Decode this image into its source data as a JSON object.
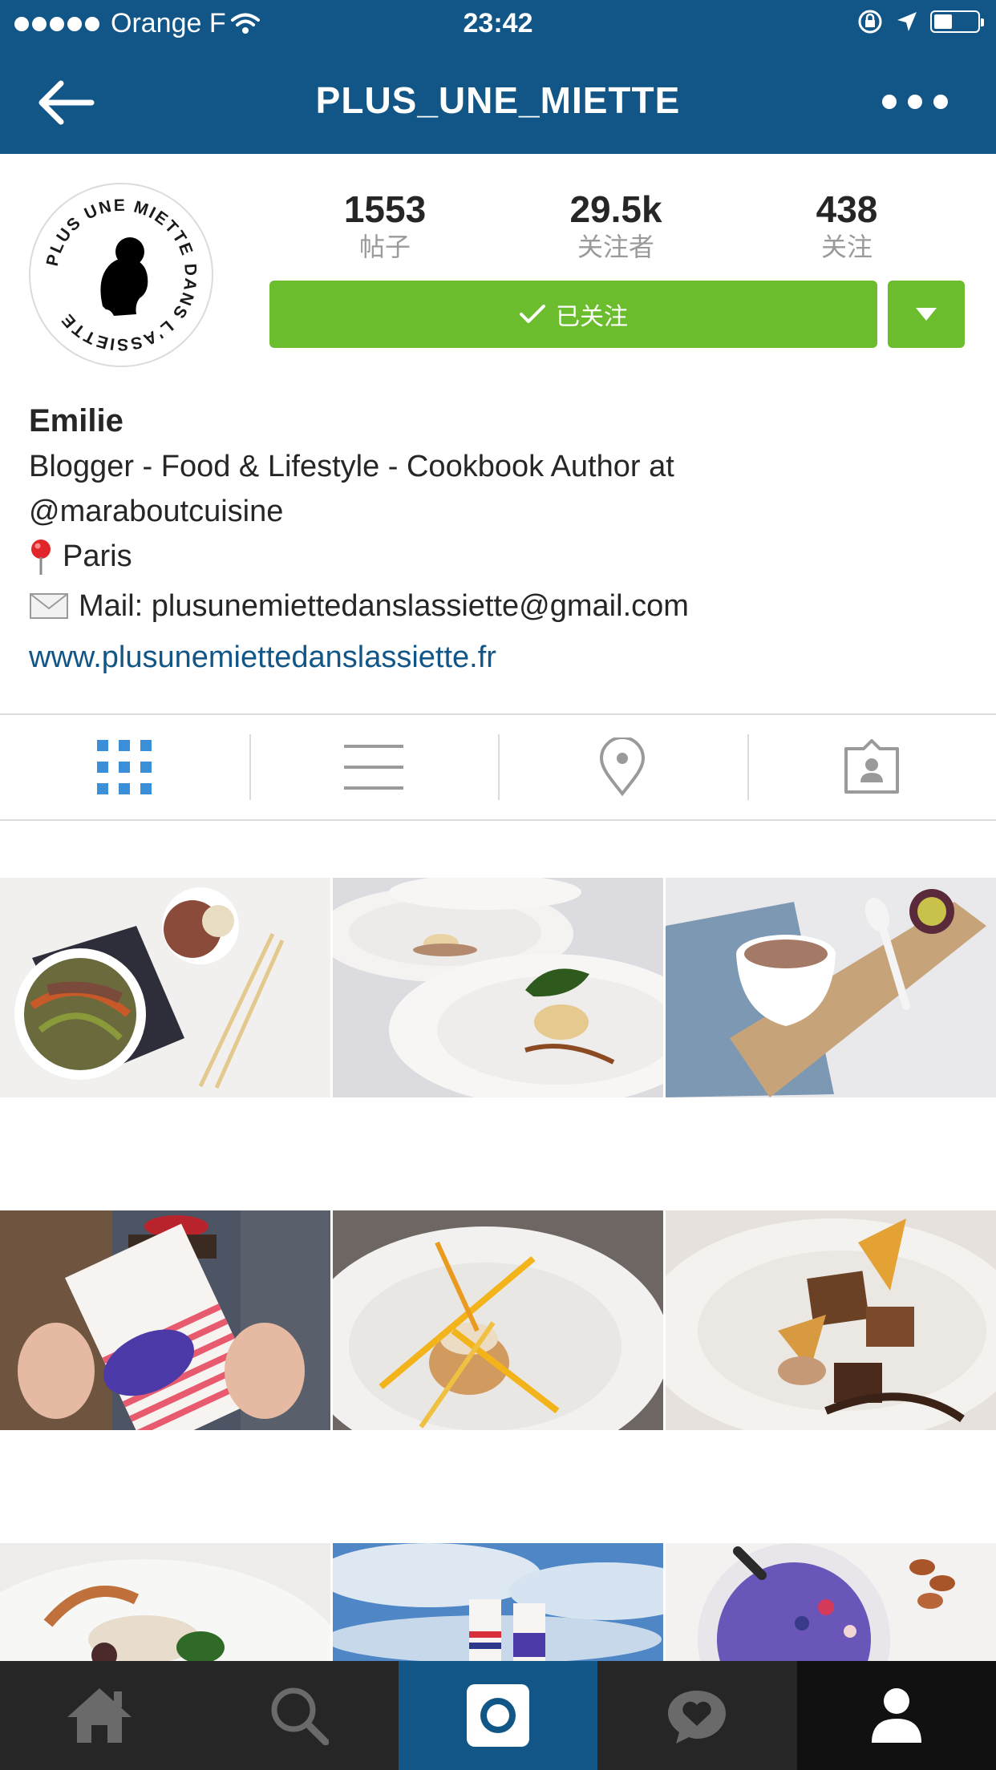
{
  "status_bar": {
    "carrier": "Orange F",
    "time": "23:42"
  },
  "nav": {
    "title": "PLUS_UNE_MIETTE",
    "back_icon": "back-arrow-icon",
    "more_icon": "more-dots-icon"
  },
  "avatar": {
    "ring_text": "PLUS UNE MIETTE DANS L'ASSIETTE"
  },
  "stats": [
    {
      "value": "1553",
      "label": "帖子"
    },
    {
      "value": "29.5k",
      "label": "关注者"
    },
    {
      "value": "438",
      "label": "关注"
    }
  ],
  "follow_button": {
    "label": "已关注"
  },
  "bio": {
    "name": "Emilie",
    "line1": "Blogger - Food & Lifestyle - Cookbook Author at",
    "line2": "@maraboutcuisine",
    "location": "Paris",
    "mail": "Mail: plusunemiettedanslassiette@gmail.com",
    "website": "www.plusunemiettedanslassiette.fr"
  },
  "profile_tabs": [
    {
      "icon": "grid-view-icon",
      "active": true
    },
    {
      "icon": "list-view-icon",
      "active": false
    },
    {
      "icon": "location-pin-icon",
      "active": false
    },
    {
      "icon": "tagged-photos-icon",
      "active": false
    }
  ],
  "bottom_tabs": [
    {
      "icon": "home-icon"
    },
    {
      "icon": "search-icon"
    },
    {
      "icon": "camera-icon"
    },
    {
      "icon": "activity-heart-icon"
    },
    {
      "icon": "profile-icon"
    }
  ],
  "colors": {
    "brand_blue": "#125688",
    "follow_green": "#6bbd2e",
    "tabbar_dark": "#262626",
    "link_blue": "#125688"
  },
  "photos": [
    {
      "subject": "salad bowls with chopsticks"
    },
    {
      "subject": "scallop plates"
    },
    {
      "subject": "chocolate mousse on board"
    },
    {
      "subject": "chocolate bar wrapper AMOUR"
    },
    {
      "subject": "plated dessert with sugar shards"
    },
    {
      "subject": "brownie dessert plate"
    },
    {
      "subject": "plated dish"
    },
    {
      "subject": "chocolate bars under sky"
    },
    {
      "subject": "purple smoothie bowl"
    }
  ]
}
